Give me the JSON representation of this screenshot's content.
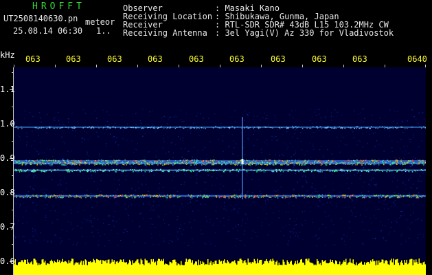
{
  "header": {
    "app_title": "HROFFT",
    "filename": "UT2508140630.pn",
    "meteor_label": "meteor",
    "datetime": "25.08.14 06:30",
    "count": "1..",
    "meta": [
      {
        "key": "Observer",
        "value": ": Masaki Kano"
      },
      {
        "key": "Receiving Location",
        "value": ": Shibukawa, Gunma, Japan"
      },
      {
        "key": "Receiver",
        "value": ": RTL-SDR SDR# 43dB L15 103.2MHz CW"
      },
      {
        "key": "Receiving Antenna",
        "value": ": 3el Yagi(V) Az 330 for Vladivostok"
      }
    ]
  },
  "y_axis": {
    "unit": "kHz",
    "labels": [
      "1.1",
      "1.0",
      "0.9",
      "0.8",
      "0.7",
      "0.6"
    ]
  },
  "x_axis": {
    "labels": [
      "063",
      "063",
      "063",
      "063",
      "063",
      "063",
      "063",
      "063",
      "063",
      "0640"
    ]
  },
  "colors": {
    "background": "#000000",
    "plot_background": "#000030",
    "title_green": "#33dd33",
    "time_yellow": "#ffff33",
    "noise_yellow": "#ffff00",
    "text": "#e8e8e8"
  },
  "spectrogram": {
    "bands_khz": [
      0.99,
      0.89,
      0.885,
      0.865,
      0.79
    ],
    "meteor_time_fraction": 0.555
  }
}
